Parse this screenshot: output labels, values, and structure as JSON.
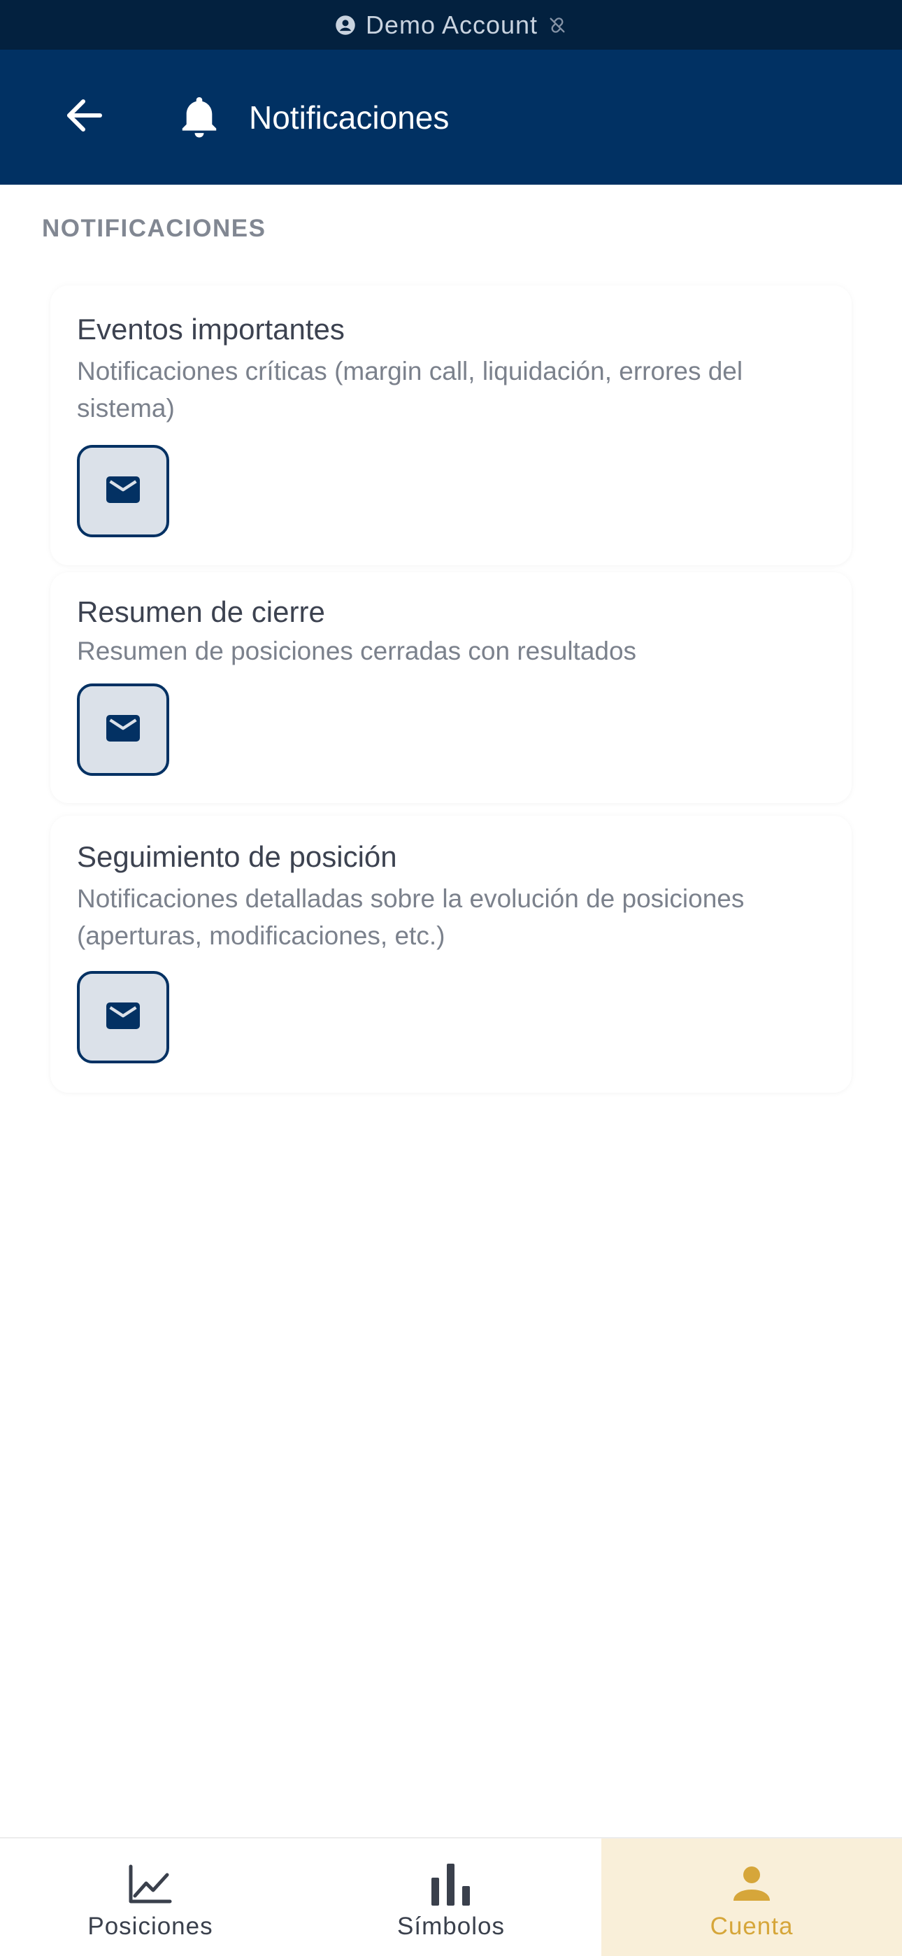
{
  "banner": {
    "label": "Demo Account",
    "icon": "account-circle-icon"
  },
  "header": {
    "title": "Notificaciones"
  },
  "section": {
    "label": "NOTIFICACIONES"
  },
  "cards": [
    {
      "title": "Eventos importantes",
      "description": "Notificaciones críticas (margin call, liquidación, errores del sistema)",
      "channel": "email",
      "enabled": true
    },
    {
      "title": "Resumen de cierre",
      "description": "Resumen de posiciones cerradas con resultados",
      "channel": "email",
      "enabled": true
    },
    {
      "title": "Seguimiento de posición",
      "description": "Notificaciones detalladas sobre la evolución de posiciones (aperturas, modificaciones, etc.)",
      "channel": "email",
      "enabled": true
    }
  ],
  "nav": {
    "items": [
      {
        "label": "Posiciones",
        "icon": "line-chart-icon",
        "active": false
      },
      {
        "label": "Símbolos",
        "icon": "bar-chart-icon",
        "active": false
      },
      {
        "label": "Cuenta",
        "icon": "person-icon",
        "active": true
      }
    ]
  },
  "colors": {
    "header": "#013163",
    "banner": "#03213f",
    "accent": "#d6a63a",
    "active_tab_bg": "#f9efd9"
  }
}
